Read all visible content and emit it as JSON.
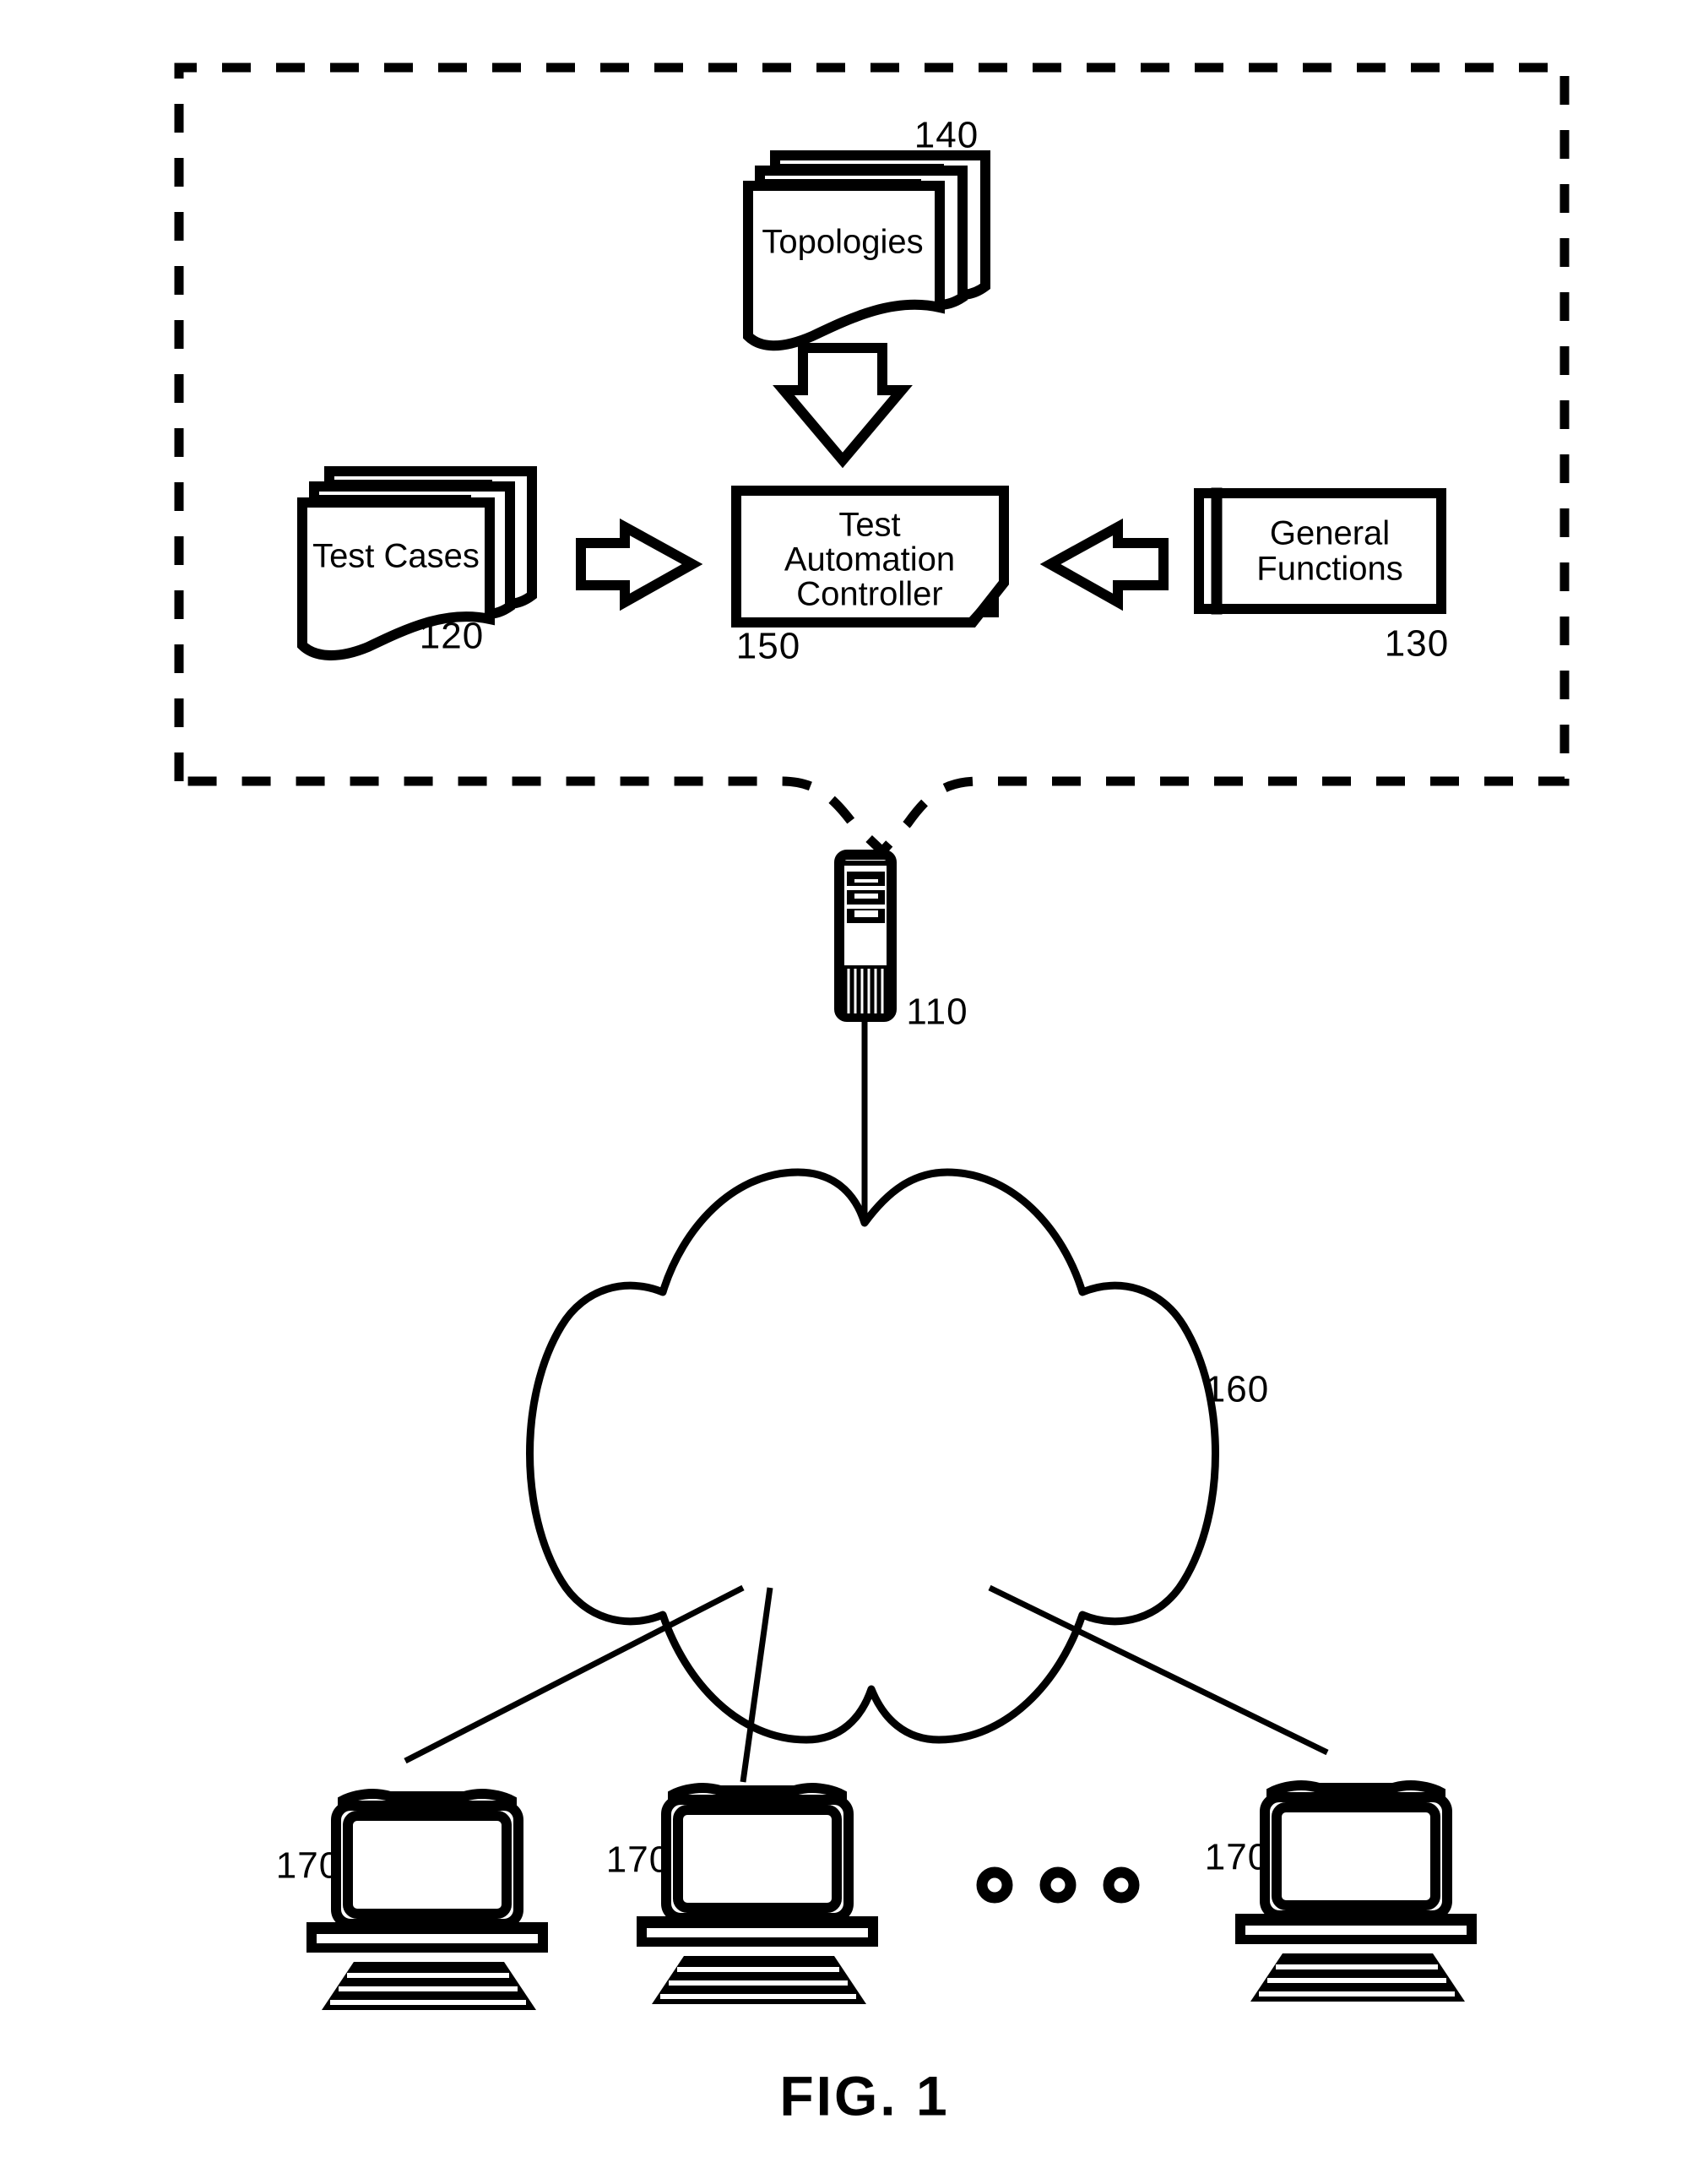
{
  "figure": {
    "caption": "FIG. 1",
    "type": "patent-system-architecture-diagram"
  },
  "nodes": {
    "topologies": {
      "label": "Topologies",
      "ref": "140",
      "icon": "stacked-documents-icon"
    },
    "test_cases": {
      "label": "Test Cases",
      "ref": "120",
      "icon": "stacked-documents-icon"
    },
    "controller": {
      "label_line1": "Test",
      "label_line2": "Automation",
      "label_line3": "Controller",
      "ref": "150",
      "icon": "folded-corner-box-icon"
    },
    "general_functions": {
      "label_line1": "General",
      "label_line2": "Functions",
      "ref": "130",
      "icon": "module-box-icon"
    },
    "server": {
      "ref": "110",
      "icon": "server-tower-icon"
    },
    "network": {
      "ref": "160",
      "icon": "cloud-icon"
    },
    "workstation_1": {
      "ref": "170",
      "icon": "desktop-computer-icon"
    },
    "workstation_2": {
      "ref": "170",
      "icon": "desktop-computer-icon"
    },
    "workstation_3": {
      "ref": "170",
      "icon": "desktop-computer-icon"
    },
    "ellipsis": {
      "icon": "ellipsis-rings-icon",
      "count": 3
    }
  },
  "arrows": [
    {
      "name": "topologies-to-controller",
      "direction": "down"
    },
    {
      "name": "test-cases-to-controller",
      "direction": "right"
    },
    {
      "name": "general-functions-to-controller",
      "direction": "left"
    }
  ],
  "colors": {
    "stroke": "#000000",
    "fill": "#ffffff"
  }
}
